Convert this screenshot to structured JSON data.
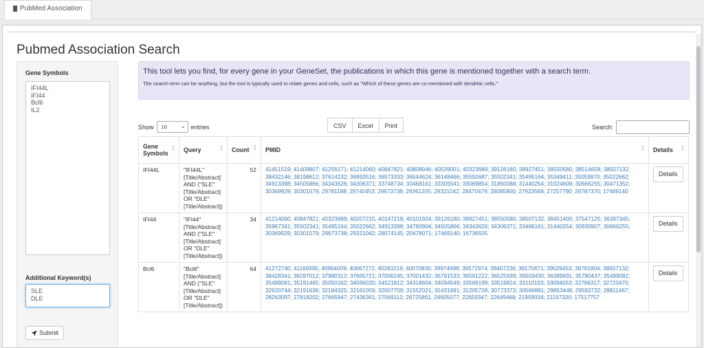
{
  "tab": {
    "label": "PubMed Association",
    "icon": "book-icon"
  },
  "page": {
    "title": "Pubmed Association Search"
  },
  "sidebar": {
    "genes_label": "Gene Symbols",
    "genes": [
      "IFI44L",
      "IFI44",
      "Bcl6",
      "IL2"
    ],
    "keyword_label": "Additional Keyword(s)",
    "keywords": [
      "SLE",
      "DLE"
    ],
    "submit_label": "Submit",
    "submit_icon": "paper-plane-icon"
  },
  "info": {
    "main": "This tool lets you find, for every gene in your GeneSet, the publications in which this gene is mentioned together with a search term.",
    "sub": "The search term can be anything, but the tool is typically used to relate genes and cells, such as \"Which of these genes are co-mentioned with dendritic cells.\""
  },
  "controls": {
    "show_label": "Show",
    "show_value": "10",
    "entries_label": "entries",
    "buttons": [
      "CSV",
      "Excel",
      "Print"
    ],
    "search_label": "Search:"
  },
  "table": {
    "headers": [
      "Gene Symbols",
      "Query",
      "Count",
      "PMID",
      "Details"
    ],
    "rows": [
      {
        "gene": "IFI44L",
        "query": "\"IFI44L\" [Title/Abstract] AND (\"SLE\" [Title/Abstract] OR \"DLE\" [Title/Abstract])",
        "count": "52",
        "pmid": "41451519; 41409807; 41256171; 41214060; 40847821; 40808946; 40539001; 40323689; 39126180; 38927451; 38550580; 38514658; 38507132; 38432146; 38198612; 37614232; 36893516; 36573333; 36544624; 36148466; 35592687; 35502341; 35495164; 35349411; 35059970; 35022662; 34913398; 34505866; 34343626; 34306371; 33748734; 33468161; 33305541; 33069854; 31850088; 31440254; 31024609; 30666255; 30471352; 30369929; 30301579; 29781188; 29740453; 29673738; 29361205; 29321042; 28470479; 28085900; 27923569; 27257790; 26787370; 17469140",
        "details": "Details"
      },
      {
        "gene": "IFI44",
        "query": "\"IFI44\" [Title/Abstract] AND (\"SLE\" [Title/Abstract] OR \"DLE\" [Title/Abstract])",
        "count": "34",
        "pmid": "41214060; 40847821; 40323689; 40207215; 40147218; 40101924; 39126180; 38927451; 38550580; 38507132; 38451400; 37547125; 36397345; 35967341; 35502341; 35495164; 35022662; 34913398; 34760904; 34505866; 34343626; 34306371; 33468161; 31440254; 30930907; 30666255; 30369929; 30301579; 29673738; 29321042; 28074145; 20478071; 17469140; 16736505",
        "details": "Details"
      },
      {
        "gene": "Bcl6",
        "query": "\"Bcl6\" [Title/Abstract] AND (\"SLE\" [Title/Abstract] OR \"DLE\" [Title/Abstract])",
        "count": "64",
        "pmid": "41272740; 41169395; 40964009; 40667272; 40283219; 40070830; 39974998; 39572974; 39407236; 39170671; 39029453; 38761804; 38507132; 38428341; 38287012; 37980312; 37665721; 37006245; 37001432; 36791533; 36591222; 36525939; 36503430; 36389691; 35780437; 35499082; 35499081; 35191465; 35050162; 34596020; 34521812; 34318604; 34094549; 33568199; 33519824; 33110193; 33094053; 32766317; 32720470; 32620744; 32191636; 32184325; 32161059; 32007709; 31552021; 31431691; 31205728; 30773373; 30566881; 29853448; 29593732; 28811467; 28263097; 27818202; 27665947; 27436361; 27069113; 26725861; 24605077; 22659347; 22649468; 21959034; 21167320; 17517757",
        "details": "Details"
      }
    ]
  }
}
